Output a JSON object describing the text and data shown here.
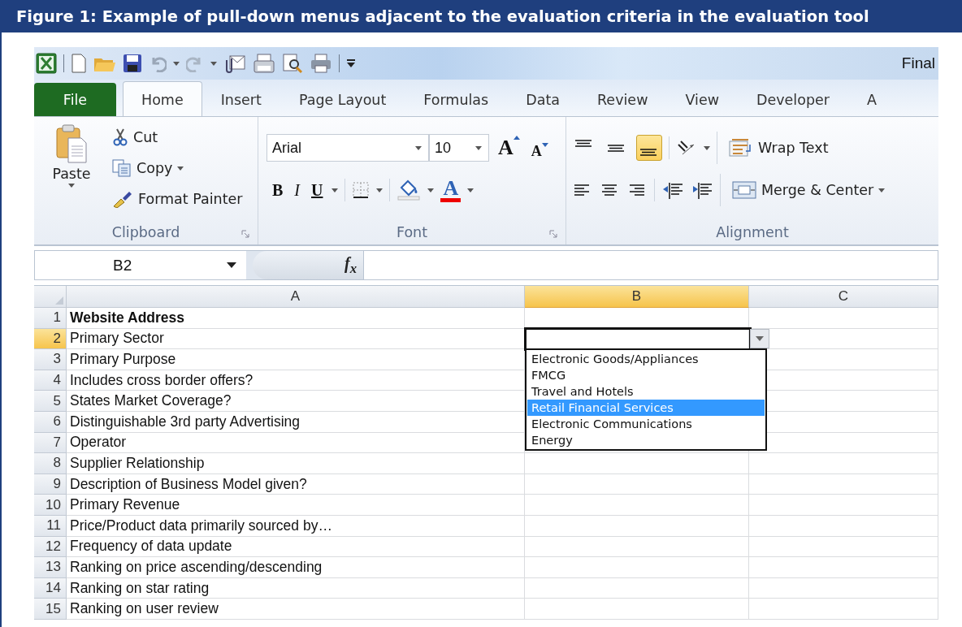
{
  "figure": {
    "caption": "Figure 1: Example of pull-down menus adjacent to the evaluation criteria in the evaluation tool"
  },
  "window": {
    "title": "Final"
  },
  "tabs": [
    {
      "label": "File",
      "kind": "file",
      "selected": false
    },
    {
      "label": "Home",
      "kind": "tab",
      "selected": true
    },
    {
      "label": "Insert",
      "kind": "tab",
      "selected": false
    },
    {
      "label": "Page Layout",
      "kind": "tab",
      "selected": false
    },
    {
      "label": "Formulas",
      "kind": "tab",
      "selected": false
    },
    {
      "label": "Data",
      "kind": "tab",
      "selected": false
    },
    {
      "label": "Review",
      "kind": "tab",
      "selected": false
    },
    {
      "label": "View",
      "kind": "tab",
      "selected": false
    },
    {
      "label": "Developer",
      "kind": "tab",
      "selected": false
    },
    {
      "label": "A",
      "kind": "tab",
      "selected": false
    }
  ],
  "clipboard": {
    "paste": "Paste",
    "cut": "Cut",
    "copy": "Copy",
    "format_painter": "Format Painter",
    "label": "Clipboard"
  },
  "font": {
    "family": "Arial",
    "size": "10",
    "grow": "A",
    "shrink": "A",
    "bold": "B",
    "italic": "I",
    "underline": "U",
    "font_color_label": "A",
    "label": "Font"
  },
  "alignment": {
    "vertical": [
      {
        "kind": "top",
        "selected": false
      },
      {
        "kind": "middle",
        "selected": false
      },
      {
        "kind": "bottom",
        "selected": true
      }
    ],
    "wrap_text": "Wrap Text",
    "merge_center": "Merge & Center",
    "label": "Alignment"
  },
  "formula_bar": {
    "name_box": "B2",
    "function_label": "f$_{x}$"
  },
  "sheet": {
    "columns": [
      {
        "label": "A",
        "selected": false
      },
      {
        "label": "B",
        "selected": true
      },
      {
        "label": "C",
        "selected": false
      }
    ],
    "rows": [
      {
        "number": "1",
        "selected": false,
        "bold": true,
        "text": "Website Address"
      },
      {
        "number": "2",
        "selected": true,
        "bold": false,
        "text": "Primary Sector"
      },
      {
        "number": "3",
        "selected": false,
        "bold": false,
        "text": "Primary Purpose"
      },
      {
        "number": "4",
        "selected": false,
        "bold": false,
        "text": "Includes cross border offers?"
      },
      {
        "number": "5",
        "selected": false,
        "bold": false,
        "text": "States Market Coverage?"
      },
      {
        "number": "6",
        "selected": false,
        "bold": false,
        "text": "Distinguishable 3rd party Advertising"
      },
      {
        "number": "7",
        "selected": false,
        "bold": false,
        "text": "Operator"
      },
      {
        "number": "8",
        "selected": false,
        "bold": false,
        "text": "Supplier Relationship"
      },
      {
        "number": "9",
        "selected": false,
        "bold": false,
        "text": "Description of Business Model given?"
      },
      {
        "number": "10",
        "selected": false,
        "bold": false,
        "text": "Primary Revenue"
      },
      {
        "number": "11",
        "selected": false,
        "bold": false,
        "text": "Price/Product data primarily sourced by…"
      },
      {
        "number": "12",
        "selected": false,
        "bold": false,
        "text": "Frequency of data update"
      },
      {
        "number": "13",
        "selected": false,
        "bold": false,
        "text": "Ranking on price ascending/descending"
      },
      {
        "number": "14",
        "selected": false,
        "bold": false,
        "text": "Ranking on star rating"
      },
      {
        "number": "15",
        "selected": false,
        "bold": false,
        "text": "Ranking on user review"
      }
    ]
  },
  "dropdown": {
    "items": [
      {
        "label": "Electronic Goods/Appliances",
        "selected": false
      },
      {
        "label": "FMCG",
        "selected": false
      },
      {
        "label": "Travel and Hotels",
        "selected": false
      },
      {
        "label": "Retail Financial Services",
        "selected": true
      },
      {
        "label": "Electronic Communications",
        "selected": false
      },
      {
        "label": "Energy",
        "selected": false
      }
    ]
  }
}
